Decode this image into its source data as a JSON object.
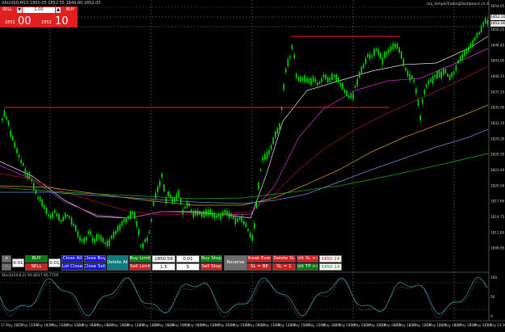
{
  "symbol_header": {
    "text": "XAUUSD,M15  1850.05 1852.55 1849.80 1852.00"
  },
  "indicator_title": "ma_SimpleTradingDashboard v3.4",
  "trade_panel": {
    "sell_label": "SELL",
    "buy_label": "BUY",
    "lot_value": "1.00",
    "sell_price_small": "1852",
    "sell_price_big": "00",
    "buy_price_small": "1852",
    "buy_price_big": "10"
  },
  "price_axis": {
    "top_price": "1854.65",
    "current_bid": "1852.00",
    "current_ask": "1852.10",
    "labels": [
      "1850.25",
      "1846.45",
      "1843.05",
      "1840.15",
      "1837.25",
      "1835.00",
      "1832.10",
      "1829.20",
      "1826.30",
      "1823.40",
      "1820.50",
      "1817.60",
      "1814.75",
      "1811.85",
      "1808.95"
    ]
  },
  "stoch": {
    "title": "Stoch(14,6,2) 91.8017 85.7705",
    "levels": [
      "100",
      "50",
      "0"
    ]
  },
  "time_axis": [
    "17 May 2022",
    "17 May 17:30",
    "17 May 19:30",
    "17 May 21:30",
    "18 May 03:30",
    "18 May 06:30",
    "18 May 08:30",
    "18 May 10:30",
    "18 May 12:30",
    "18 May 14:30",
    "18 May 16:30",
    "18 May 19:00",
    "19 May 00:30",
    "19 May 03:00",
    "19 May 05:30",
    "19 May 07:30",
    "19 May 09:30",
    "19 May 11:30",
    "19 May 13:30",
    "19 May 15:30",
    "19 May 17:30",
    "19 May 20:00",
    "20 May 01:30",
    "20 May 03:30",
    "20 May 05:30",
    "20 May 08:30",
    "20 May 10:30",
    "20 May 12:30",
    "20 May 14:30",
    "20 May 16:30",
    "20 May 18:30",
    "23 May 01:30",
    "23 May 03:30"
  ],
  "dashboard": {
    "plus": "+",
    "minus": "-",
    "lot_left": "0.01",
    "lot_mid": "0.01",
    "buy": "BUY",
    "sell": "SELL",
    "close_all": "Close All",
    "close_buy": "Close Buy",
    "lot_close": "Lot Close",
    "close_sell": "Close Sell",
    "delete_all": "Delete All",
    "buy_limit": "Buy Limit",
    "buy_limit_price": "1850.58",
    "buy_limit_lot": "0.01",
    "sell_limit": "Sell Limit",
    "sell_limit_val": "1.5",
    "sell_limit_lot": "5",
    "buy_stop": "Buy Stop",
    "sell_stop": "Sell Stop",
    "reverse": "Reverse",
    "break_even": "Break Even",
    "delete_sl": "Delete SL",
    "edit_sl": "Edit SL >>",
    "edit_sl_val": "1850.14",
    "sl_be": "SL = BE",
    "sl_1": "SL = 1",
    "edit_tp": "Edit TP >>",
    "edit_tp_val": "1850.14"
  },
  "colors": {
    "bull": "#00dd00",
    "red_line": "#ff1a1a",
    "ma_white": "#e8e8e8",
    "ma_magenta": "#cc33cc",
    "ma_darkred": "#a01818",
    "ma_orange": "#d49a2a",
    "ma_blue": "#6f8fd8",
    "ma_green": "#22aa22"
  }
}
